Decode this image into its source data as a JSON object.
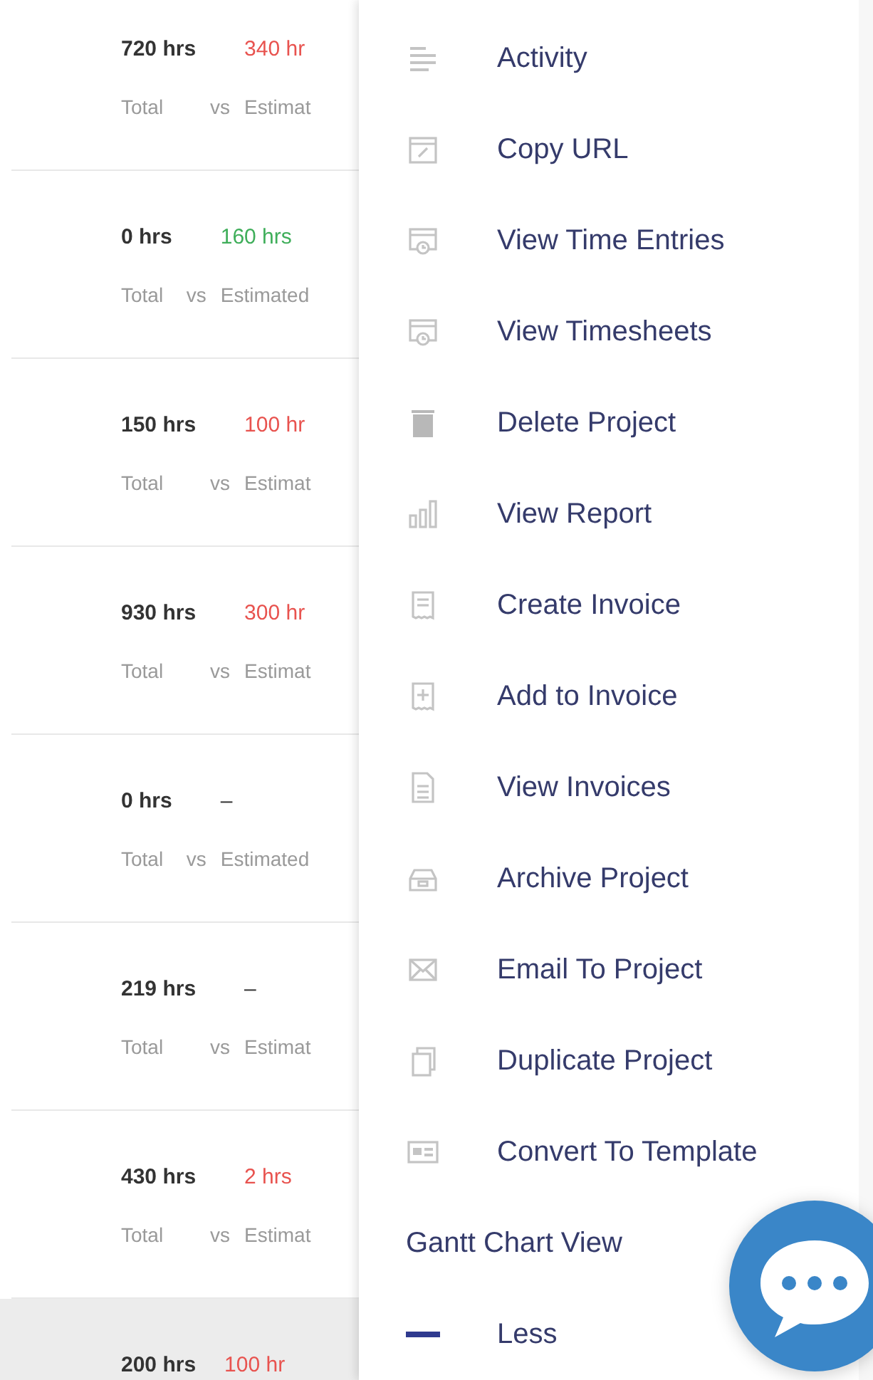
{
  "projects": [
    {
      "total": "720 hrs",
      "estimate": "340 hr",
      "color": "#e8534f",
      "total_label": "Total",
      "vs_label": "vs",
      "estimate_label": "Estimat",
      "highlighted": false
    },
    {
      "total": "0 hrs",
      "estimate": "160 hrs",
      "color": "#3fae5a",
      "total_label": "Total",
      "vs_label": "vs",
      "estimate_label": "Estimated",
      "highlighted": false
    },
    {
      "total": "150 hrs",
      "estimate": "100 hr",
      "color": "#e8534f",
      "total_label": "Total",
      "vs_label": "vs",
      "estimate_label": "Estimat",
      "highlighted": false
    },
    {
      "total": "930 hrs",
      "estimate": "300 hr",
      "color": "#e8534f",
      "total_label": "Total",
      "vs_label": "vs",
      "estimate_label": "Estimat",
      "highlighted": false
    },
    {
      "total": "0 hrs",
      "estimate": "–",
      "color": "#333333",
      "total_label": "Total",
      "vs_label": "vs",
      "estimate_label": "Estimated",
      "highlighted": false
    },
    {
      "total": "219 hrs",
      "estimate": "–",
      "color": "#333333",
      "total_label": "Total",
      "vs_label": "vs",
      "estimate_label": "Estimat",
      "highlighted": false
    },
    {
      "total": "430 hrs",
      "estimate": "2 hrs",
      "color": "#e8534f",
      "total_label": "Total",
      "vs_label": "vs",
      "estimate_label": "Estimat",
      "highlighted": false
    },
    {
      "total": "200 hrs",
      "estimate": "100 hr",
      "color": "#e8534f",
      "highlighted": true
    }
  ],
  "menu": [
    {
      "kind": "action",
      "label": "Activity"
    },
    {
      "kind": "action",
      "label": "Copy URL"
    },
    {
      "kind": "action",
      "label": "View Time Entries"
    },
    {
      "kind": "action",
      "label": "View Timesheets"
    },
    {
      "kind": "action",
      "label": "Delete Project"
    },
    {
      "kind": "action",
      "label": "View Report"
    },
    {
      "kind": "action",
      "label": "Create Invoice"
    },
    {
      "kind": "action",
      "label": "Add to Invoice"
    },
    {
      "kind": "action",
      "label": "View Invoices"
    },
    {
      "kind": "action",
      "label": "Archive Project"
    },
    {
      "kind": "action",
      "label": "Email To Project"
    },
    {
      "kind": "action",
      "label": "Duplicate Project"
    },
    {
      "kind": "action",
      "label": "Convert To Template"
    },
    {
      "kind": "link",
      "label": "Gantt Chart View"
    },
    {
      "kind": "toggle",
      "label": "Less"
    }
  ]
}
